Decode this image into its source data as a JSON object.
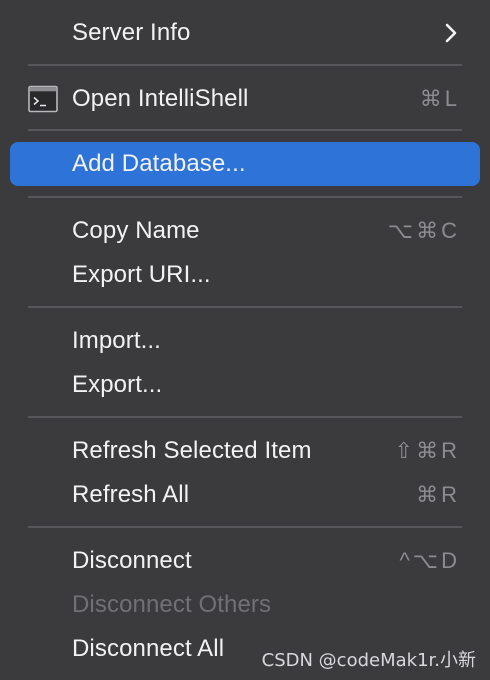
{
  "menu": {
    "items": [
      {
        "label": "Server Info",
        "shortcut": ""
      },
      {
        "label": "Open IntelliShell",
        "shortcut": "⌘L"
      },
      {
        "label": "Add Database...",
        "shortcut": ""
      },
      {
        "label": "Copy Name",
        "shortcut": "⌥⌘C"
      },
      {
        "label": "Export URI...",
        "shortcut": ""
      },
      {
        "label": "Import...",
        "shortcut": ""
      },
      {
        "label": "Export...",
        "shortcut": ""
      },
      {
        "label": "Refresh Selected Item",
        "shortcut": "⇧⌘R"
      },
      {
        "label": "Refresh All",
        "shortcut": "⌘R"
      },
      {
        "label": "Disconnect",
        "shortcut": "^⌥D"
      },
      {
        "label": "Disconnect Others",
        "shortcut": ""
      },
      {
        "label": "Disconnect All",
        "shortcut": ""
      }
    ],
    "highlighted_index": 2,
    "disabled": [
      "Disconnect Others"
    ],
    "icons": {
      "submenu": "chevron-right-icon",
      "intellishell": "terminal-icon"
    },
    "colors": {
      "background": "#3b3b3e",
      "highlight": "#2e73d8",
      "text": "#f2f2f2",
      "shortcut": "#8c8c90",
      "disabled_text": "#707075",
      "separator": "#58585c"
    }
  },
  "watermark": "CSDN @codeMak1r.小新"
}
